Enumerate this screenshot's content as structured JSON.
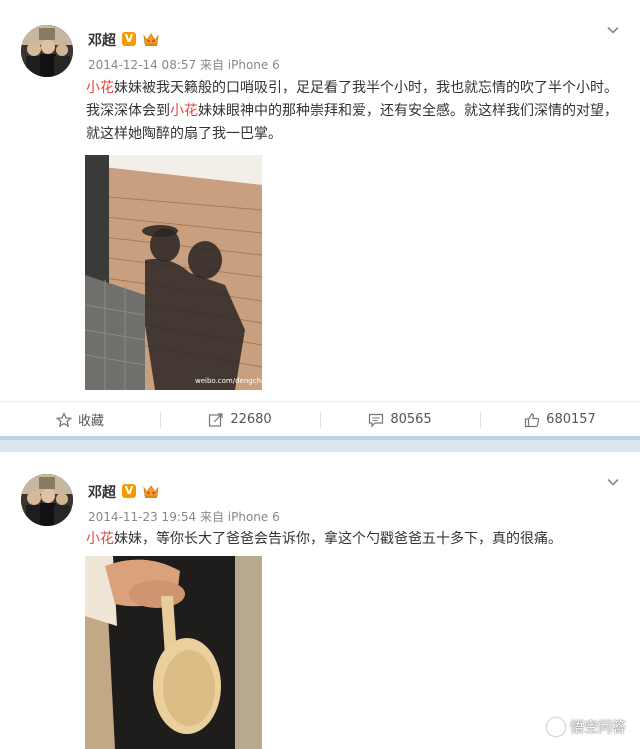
{
  "posts": [
    {
      "username": "邓超",
      "verified_badge": "V",
      "timestamp": "2014-12-14 08:57",
      "source": "来自 iPhone 6",
      "text": [
        {
          "t": "小花",
          "hl": true
        },
        {
          "t": "妹妹被我天籁般的口哨吸引，足足看了我半个小时，我也就忘情的吹了半个小时。我深深体会到",
          "hl": false
        },
        {
          "t": "小花",
          "hl": true
        },
        {
          "t": "妹妹眼神中的那种崇拜和爱，还有安全感。就这样我们深情的对望，就这样她陶醉的扇了我一巴掌。",
          "hl": false
        }
      ],
      "photo_watermark": "weibo.com/dengchao",
      "actions": {
        "favorite": "收藏",
        "repost": "22680",
        "comment": "80565",
        "like": "680157"
      }
    },
    {
      "username": "邓超",
      "verified_badge": "V",
      "timestamp": "2014-11-23 19:54",
      "source": "来自 iPhone 6",
      "text": [
        {
          "t": "小花",
          "hl": true
        },
        {
          "t": "妹妹，等你长大了爸爸会告诉你，拿这个勺戳爸爸五十多下，真的很痛。",
          "hl": false
        }
      ]
    }
  ],
  "watermark": "悟空问答",
  "colors": {
    "highlight": "#e8453c",
    "verified": "#f59b00",
    "page_bg": "#dde6ee"
  },
  "icons": [
    "more-chevron-icon",
    "crown-icon",
    "star-icon",
    "repost-icon",
    "comment-icon",
    "thumbs-up-icon"
  ]
}
